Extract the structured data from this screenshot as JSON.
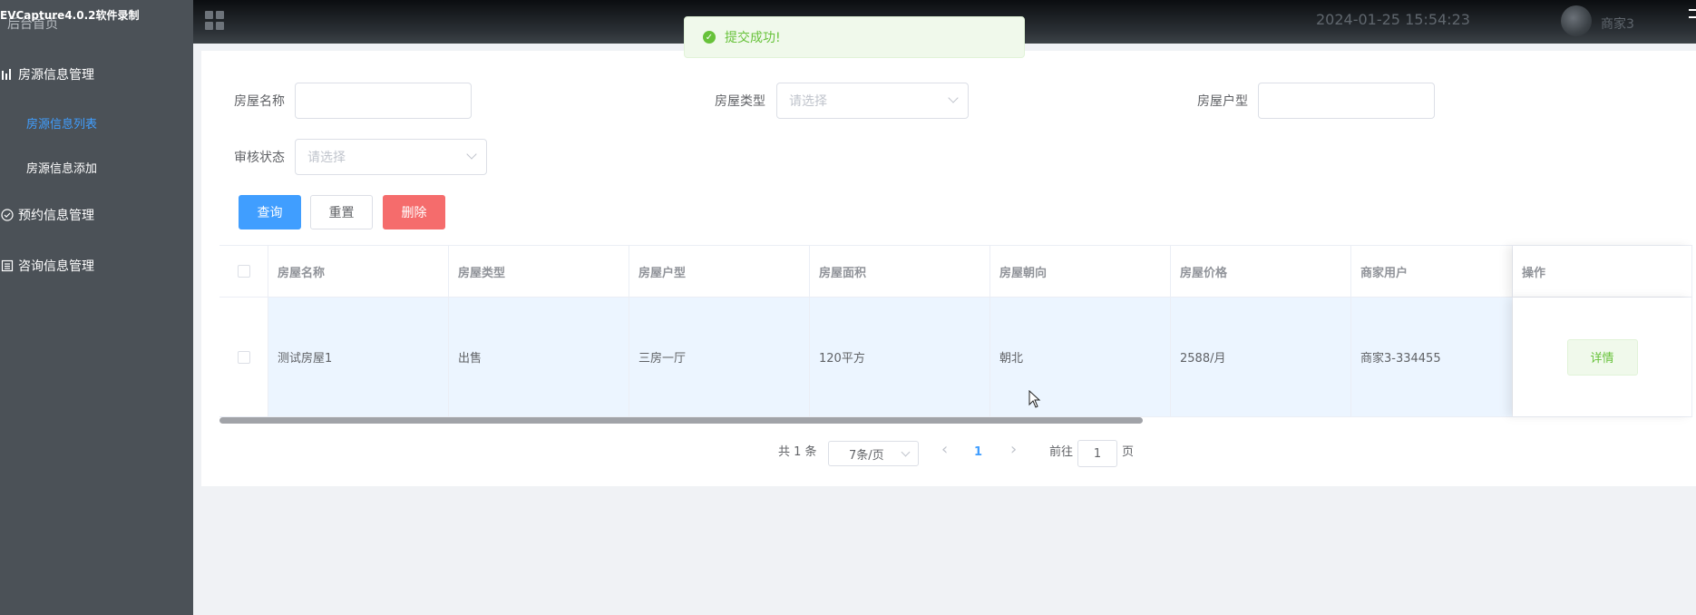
{
  "recorder_label": "EVCapture4.0.2软件录制",
  "sidebar": {
    "home": "后台首页",
    "groups": [
      {
        "label": "房源信息管理",
        "icon": "bar-chart-icon"
      },
      {
        "label": "预约信息管理",
        "icon": "check-circle-icon"
      },
      {
        "label": "咨询信息管理",
        "icon": "list-icon"
      }
    ],
    "submenu": [
      {
        "label": "房源信息列表",
        "active": true
      },
      {
        "label": "房源信息添加",
        "active": false
      }
    ]
  },
  "header": {
    "datetime": "2024-01-25 15:54:23",
    "user": "商家3"
  },
  "toast": {
    "message": "提交成功!"
  },
  "form": {
    "house_name_label": "房屋名称",
    "house_type_label": "房屋类型",
    "house_type_placeholder": "请选择",
    "house_layout_label": "房屋户型",
    "audit_status_label": "审核状态",
    "audit_status_placeholder": "请选择"
  },
  "buttons": {
    "query": "查询",
    "reset": "重置",
    "delete": "删除"
  },
  "table": {
    "columns": [
      "房屋名称",
      "房屋类型",
      "房屋户型",
      "房屋面积",
      "房屋朝向",
      "房屋价格",
      "商家用户",
      "操作"
    ],
    "rows": [
      {
        "name": "测试房屋1",
        "type": "出售",
        "layout": "三房一厅",
        "area": "120平方",
        "orientation": "朝北",
        "price": "2588/月",
        "merchant": "商家3-334455",
        "action": "详情"
      }
    ]
  },
  "pagination": {
    "total": "共 1 条",
    "page_size": "7条/页",
    "current_page": "1",
    "goto_label": "前往",
    "goto_value": "1",
    "page_suffix": "页",
    "prev": "‹",
    "next": "›"
  },
  "colors": {
    "primary": "#409eff",
    "danger": "#f56c6c",
    "success": "#67c23a",
    "sidebar_bg": "#4b5157"
  }
}
